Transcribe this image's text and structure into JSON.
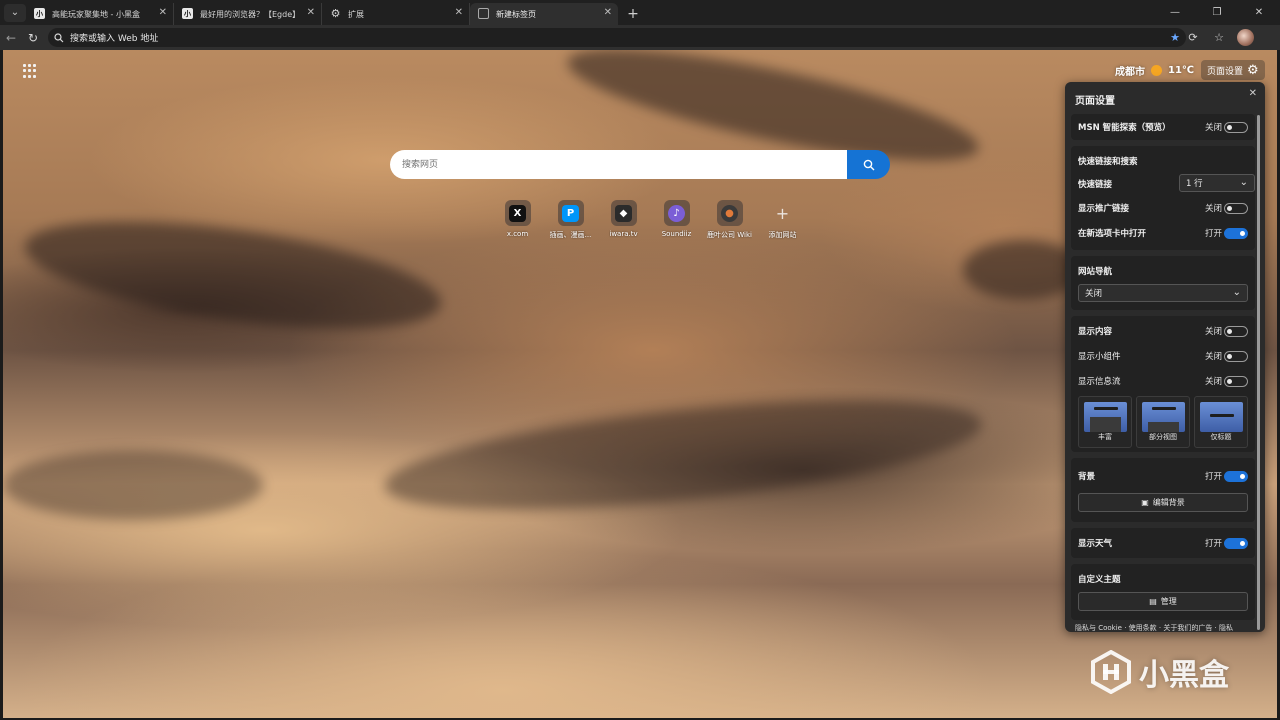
{
  "tabs": [
    {
      "label": "高能玩家聚集地 - 小黑盒",
      "favicon": "小",
      "active": false
    },
    {
      "label": "最好用的浏览器？【Egde】完全体",
      "favicon": "小",
      "active": false
    },
    {
      "label": "扩展",
      "favicon": "gear",
      "active": false
    },
    {
      "label": "新建标签页",
      "favicon": "blank",
      "active": true
    }
  ],
  "address": {
    "placeholder": "搜索或输入 Web 地址"
  },
  "weather": {
    "city": "成都市",
    "temp": "11℃"
  },
  "page_settings_button": "页面设置",
  "search": {
    "placeholder": "搜索网页"
  },
  "quicklinks": [
    {
      "label": "x.com",
      "glyph": "X",
      "color": "#111111"
    },
    {
      "label": "插画、漫画...",
      "glyph": "P",
      "color": "#0096fa"
    },
    {
      "label": "iwara.tv",
      "glyph": "◆",
      "color": "#2b2b2b"
    },
    {
      "label": "Soundiiz",
      "glyph": "♪",
      "color": "#7b5ed6"
    },
    {
      "label": "鹿叶公司 Wiki",
      "glyph": "●",
      "color": "#3a3a3a"
    },
    {
      "label": "添加网站",
      "glyph": "+",
      "color": "transparent"
    }
  ],
  "panel": {
    "title": "页面设置",
    "msn": {
      "label": "MSN 智能探索（预览）",
      "state": "关闭"
    },
    "quick": {
      "heading": "快速链接和搜索",
      "links_label": "快速链接",
      "links_value": "1 行",
      "promo_label": "显示推广链接",
      "promo_state": "关闭",
      "newtab_label": "在新选项卡中打开",
      "newtab_state": "打开"
    },
    "nav": {
      "heading": "网站导航",
      "value": "关闭"
    },
    "content": {
      "show_content": "显示内容",
      "show_content_state": "关闭",
      "widgets": "显示小组件",
      "widgets_state": "关闭",
      "feed": "显示信息流",
      "feed_state": "关闭",
      "layouts": [
        "丰富",
        "部分视图",
        "仅标题"
      ]
    },
    "background": {
      "label": "背景",
      "state": "打开",
      "edit": "编辑背景"
    },
    "weather": {
      "label": "显示天气",
      "state": "打开"
    },
    "theme": {
      "label": "自定义主题",
      "manage": "管理"
    },
    "footer": "隐私与 Cookie · 使用条款 · 关于我们的广告 · 隐私"
  },
  "watermark": "小黑盒"
}
